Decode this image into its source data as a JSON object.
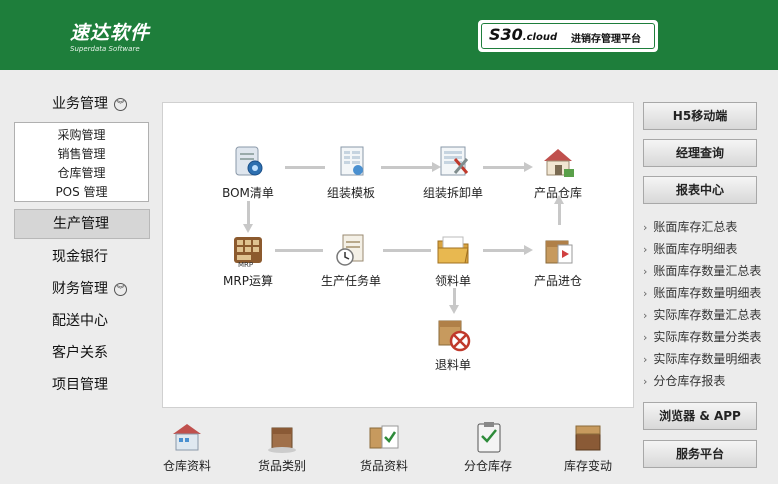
{
  "header": {
    "logo_text": "速达软件",
    "logo_sub": "Superdata Software",
    "platform_brand": "S30",
    "platform_brand_suffix": ".cloud",
    "platform_name": "进销存管理平台",
    "colors": {
      "header_bg": "#1e7e3b"
    }
  },
  "left_nav": {
    "business": "业务管理",
    "sub_items": [
      "采购管理",
      "销售管理",
      "仓库管理",
      "POS 管理"
    ],
    "production": "生产管理",
    "cash": "现金银行",
    "finance": "财务管理",
    "delivery": "配送中心",
    "customer": "客户关系",
    "project": "项目管理"
  },
  "flow": {
    "bom": "BOM清单",
    "assembly_template": "组装模板",
    "assembly_disassembly": "组装拆卸单",
    "product_warehouse": "产品仓库",
    "mrp": "MRP运算",
    "production_task": "生产任务单",
    "material_requisition": "领料单",
    "product_inbound": "产品进仓",
    "material_return": "退料单"
  },
  "bottom": {
    "warehouse_info": "仓库资料",
    "goods_category": "货品类别",
    "goods_info": "货品资料",
    "branch_inventory": "分仓库存",
    "inventory_change": "库存变动"
  },
  "right": {
    "h5_mobile": "H5移动端",
    "manager_query": "经理查询",
    "report_center": "报表中心",
    "reports": [
      "账面库存汇总表",
      "账面库存明细表",
      "账面库存数量汇总表",
      "账面库存数量明细表",
      "实际库存数量汇总表",
      "实际库存数量分类表",
      "实际库存数量明细表",
      "分仓库存报表"
    ],
    "browser_app": "浏览器 & APP",
    "service_platform": "服务平台"
  }
}
